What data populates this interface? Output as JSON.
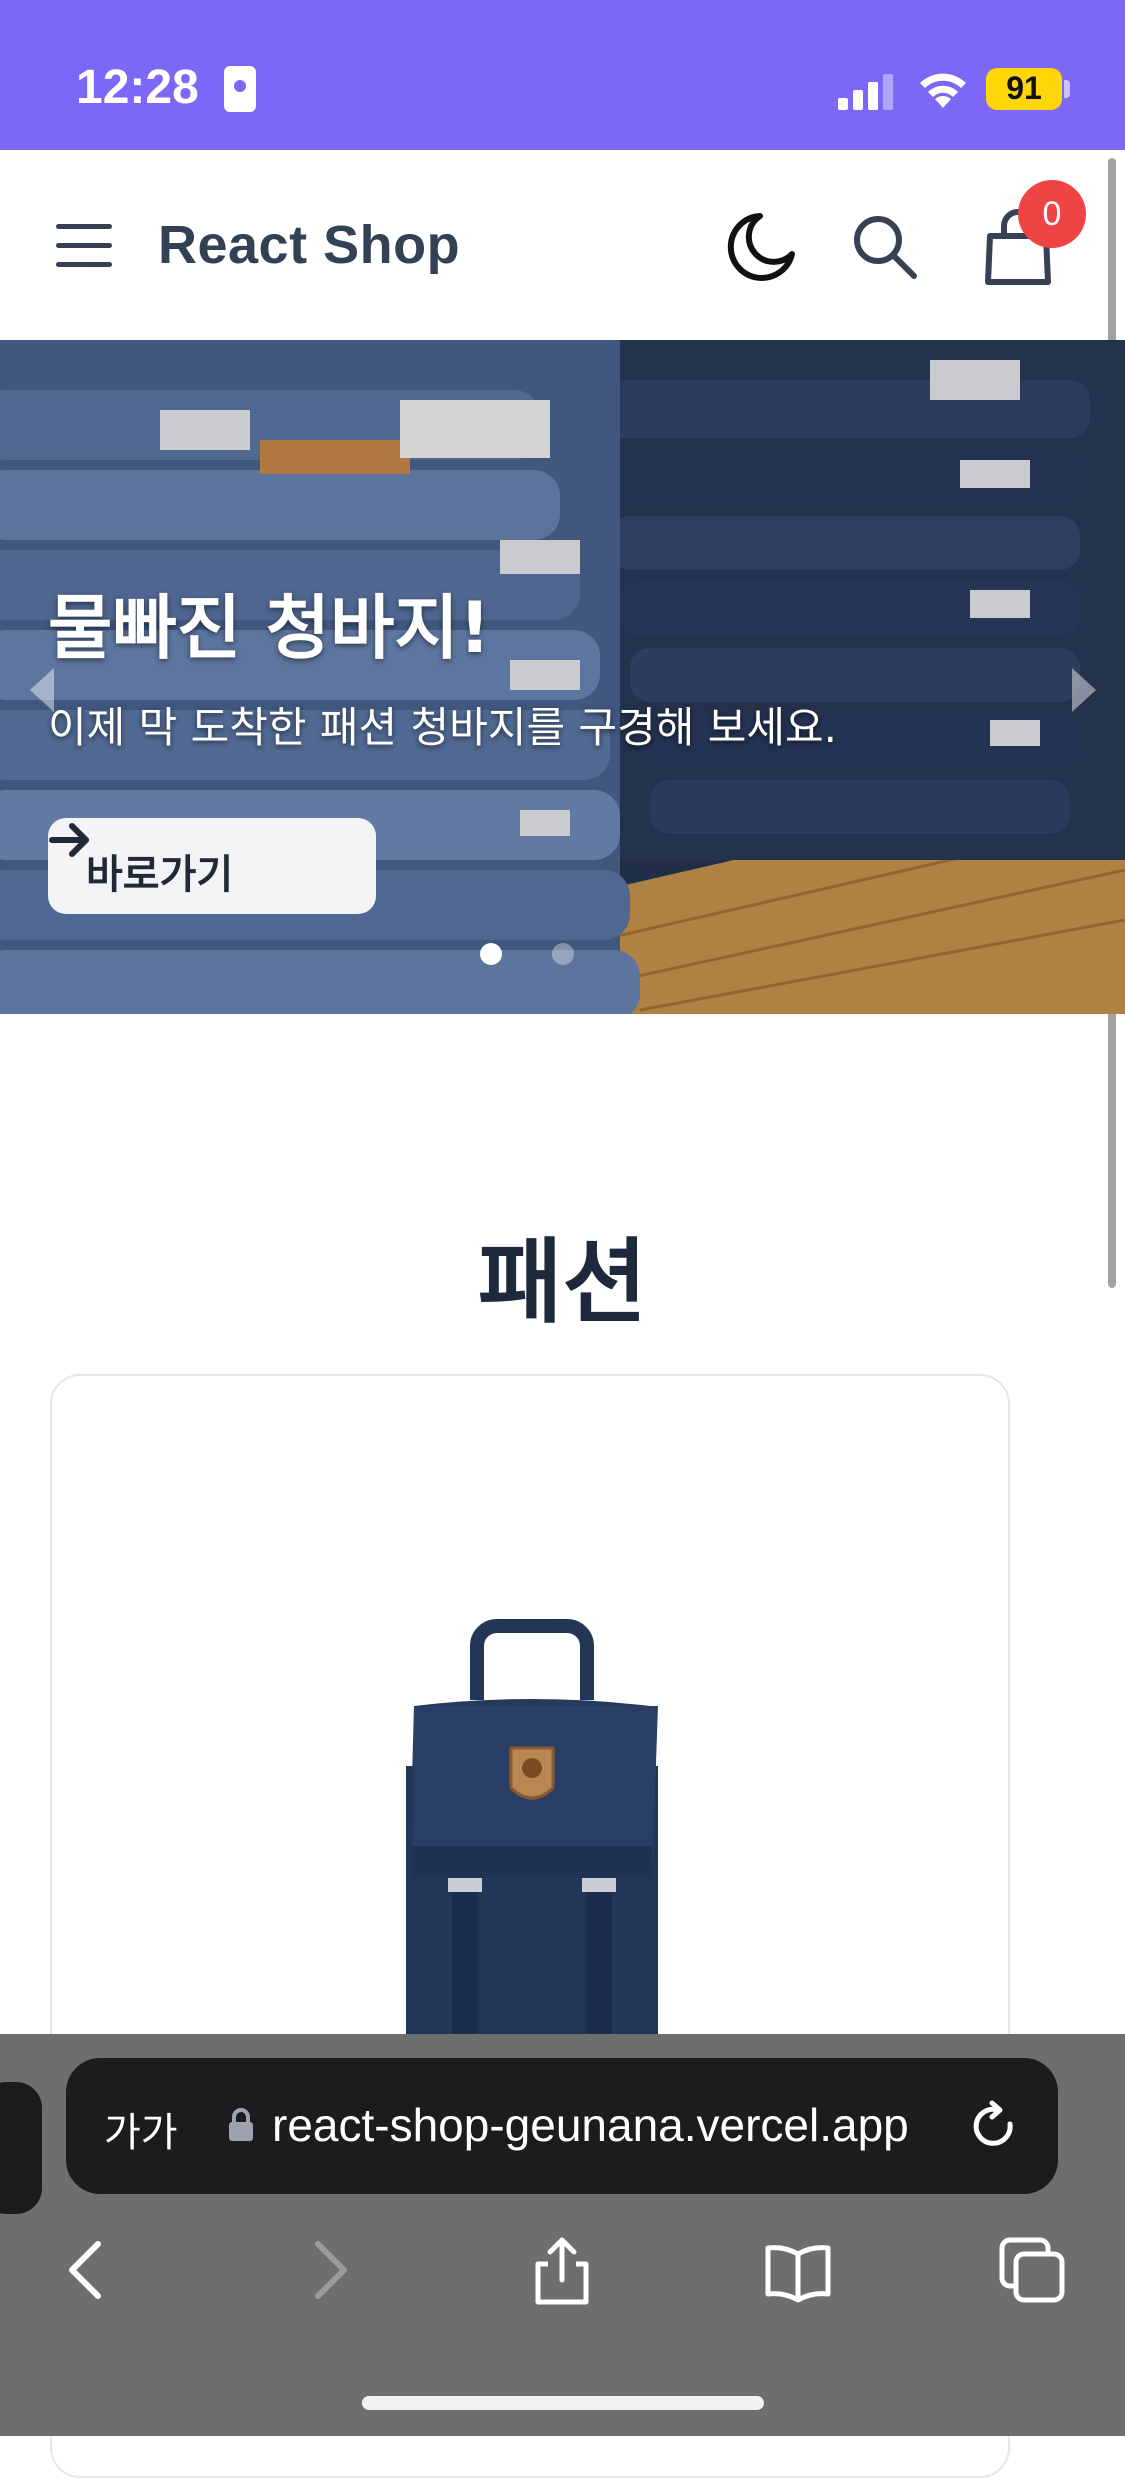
{
  "status_bar": {
    "time": "12:28",
    "battery": "91",
    "colors": {
      "background": "#7b68f6",
      "battery": "#ffd60a"
    }
  },
  "navbar": {
    "brand": "React Shop",
    "icons": [
      "hamburger-menu-icon",
      "moon-icon",
      "search-icon",
      "shopping-bag-icon"
    ],
    "cart_count": "0",
    "badge_color": "#ef4444"
  },
  "hero": {
    "title": "물빠진 청바지!",
    "subtitle": "이제 막 도착한 패션 청바지를 구경해 보세요.",
    "button_label": "바로가기",
    "active_slide": 1,
    "slide_count": 2
  },
  "section": {
    "title": "패션"
  },
  "browser": {
    "text_size_label": "가가",
    "url": "react-shop-geunana.vercel.app",
    "toolbar_icons": [
      "back-icon",
      "forward-icon",
      "share-icon",
      "bookmarks-icon",
      "tabs-icon"
    ]
  }
}
